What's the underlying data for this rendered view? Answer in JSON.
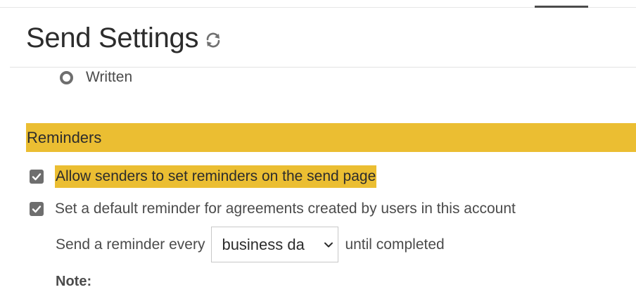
{
  "header": {
    "title": "Send Settings",
    "refresh_icon": "refresh-icon"
  },
  "radio_option": {
    "label": "Written",
    "selected": false
  },
  "reminders": {
    "section_title": "Reminders",
    "options": [
      {
        "label": "Allow senders to set reminders on the send page",
        "checked": true,
        "highlighted": true
      },
      {
        "label": "Set a default reminder for agreements created by users in this account",
        "checked": true,
        "highlighted": false
      }
    ],
    "frequency": {
      "prefix": "Send a reminder every",
      "selected": "business da",
      "suffix": "until completed"
    },
    "note_label": "Note:"
  },
  "colors": {
    "highlight": "#ebbe32",
    "checkbox": "#6e6e6e",
    "text": "#4b4b4b"
  }
}
